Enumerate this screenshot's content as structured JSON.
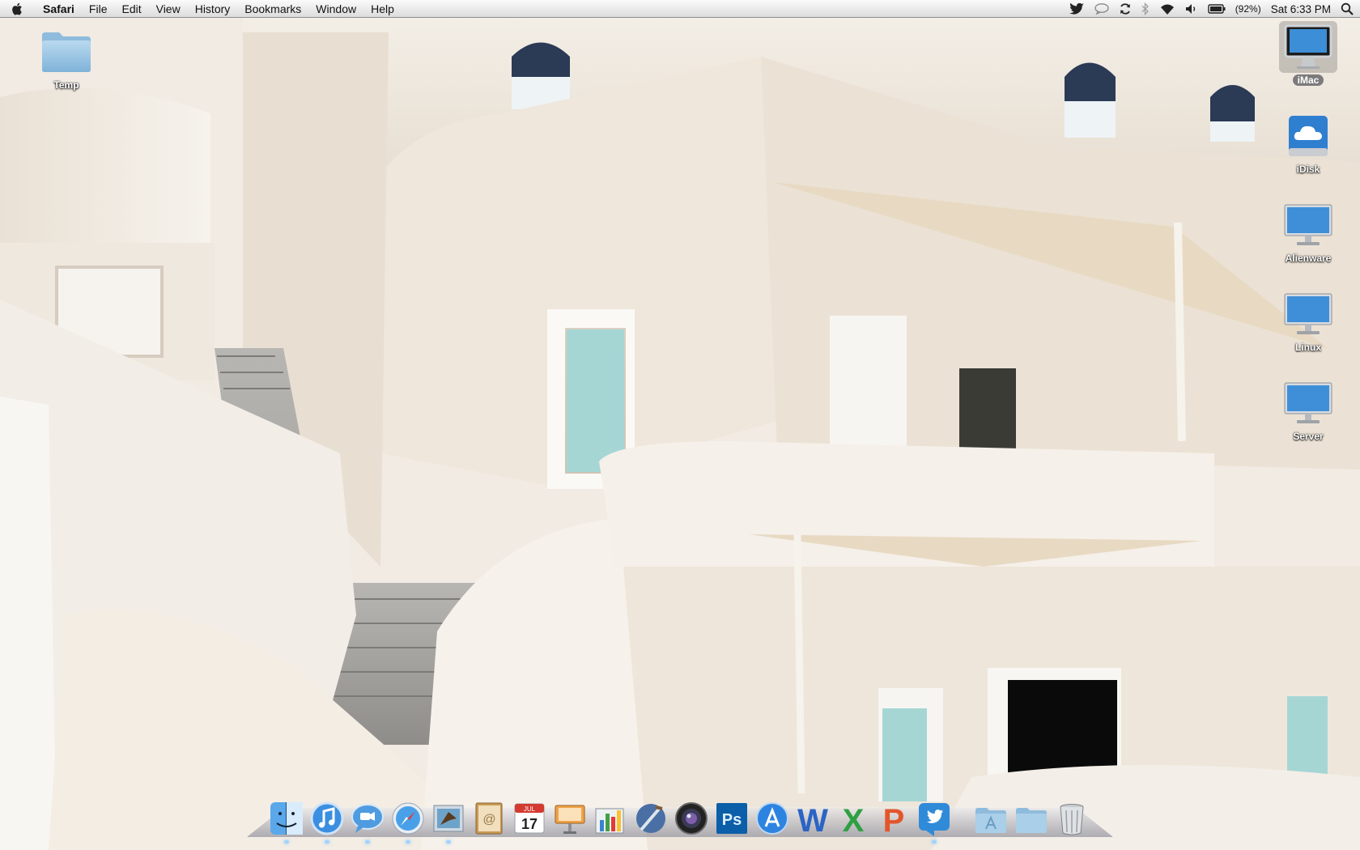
{
  "menubar": {
    "app_name": "Safari",
    "menus": [
      "File",
      "Edit",
      "View",
      "History",
      "Bookmarks",
      "Window",
      "Help"
    ],
    "status": {
      "battery_percent": "(92%)",
      "clock": "Sat 6:33 PM",
      "icons": [
        "twitter-icon",
        "chat-icon",
        "sync-icon",
        "bluetooth-icon",
        "wifi-icon",
        "volume-icon",
        "battery-icon",
        "spotlight-icon"
      ]
    }
  },
  "desktop": {
    "icons": [
      {
        "label": "Temp",
        "type": "folder"
      },
      {
        "label": "iMac",
        "type": "computer",
        "selected": true
      },
      {
        "label": "iDisk",
        "type": "idisk"
      },
      {
        "label": "Alienware",
        "type": "display"
      },
      {
        "label": "Linux",
        "type": "display"
      },
      {
        "label": "Server",
        "type": "display"
      }
    ]
  },
  "dock": {
    "apps": [
      "Finder",
      "iTunes",
      "iChat",
      "Safari",
      "Mail",
      "Address Book",
      "iCal",
      "Keynote",
      "Numbers",
      "Xcode",
      "Aperture",
      "Photoshop",
      "App Store",
      "Word",
      "Excel",
      "PowerPoint",
      "Twitter"
    ],
    "ical_date": "17",
    "ical_month": "JUL",
    "photoshop_text": "Ps",
    "word_text": "W",
    "excel_text": "X",
    "powerpoint_text": "P",
    "stacks": [
      "Applications",
      "Documents"
    ],
    "trash": "Trash"
  },
  "colors": {
    "menubar_top": "#fbfbfb",
    "menubar_bottom": "#dcdcdc",
    "wall_light": "#f4efe8",
    "wall_shadow": "#ddd3c5",
    "awning": "#e8d9c3",
    "window_glass": "#a6d6d4"
  }
}
